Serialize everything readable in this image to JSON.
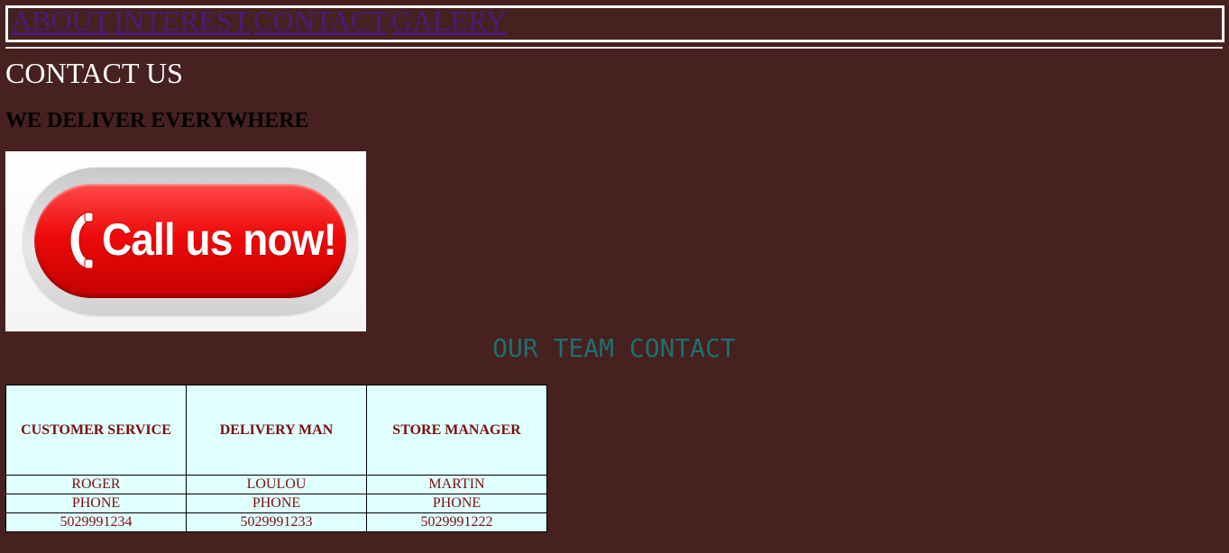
{
  "nav": {
    "links": [
      "ABOUT",
      "INTEREST",
      "CONTACT",
      "GALERY"
    ]
  },
  "page_title": "CONTACT US",
  "subtitle": "WE DELIVER EVERYWHERE",
  "callus_banner": {
    "text": "Call us now!",
    "icon": "phone-icon"
  },
  "team": {
    "title": "OUR TEAM CONTACT",
    "headers": [
      "CUSTOMER SERVICE",
      "DELIVERY MAN",
      "STORE MANAGER"
    ],
    "rows": [
      [
        "ROGER",
        "LOULOU",
        "MARTIN"
      ],
      [
        "PHONE",
        "PHONE",
        "PHONE"
      ],
      [
        "5029991234",
        "5029991233",
        "5029991222"
      ]
    ]
  },
  "colors": {
    "background": "#472020",
    "nav_link": "#4b1a7a",
    "team_title": "#1e7070",
    "table_bg": "#e0ffff",
    "table_text": "#7a0f0f"
  }
}
